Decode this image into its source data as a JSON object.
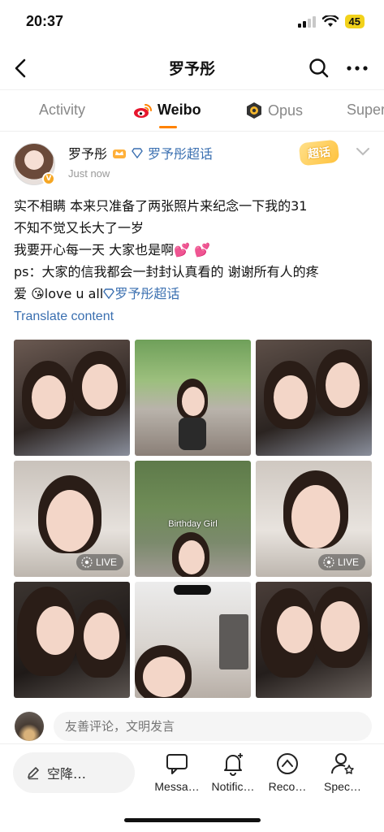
{
  "status": {
    "time": "20:37",
    "battery": "45"
  },
  "header": {
    "title": "罗予彤"
  },
  "tabs": [
    {
      "label": "Activity"
    },
    {
      "label": "Weibo"
    },
    {
      "label": "Opus"
    },
    {
      "label": "Super"
    }
  ],
  "post": {
    "author": "罗予彤",
    "supertopic": "罗予彤超话",
    "super_tag": "超话",
    "time": "Just now",
    "lines": [
      "实不相瞒 本来只准备了两张照片来纪念一下我的31",
      "不知不觉又长大了一岁",
      "我要开心每一天 大家也是啊💕 💕",
      "ps：大家的信我都会一封封认真看的 谢谢所有人的疼",
      "爱 😘love u all"
    ],
    "inline_topic": "罗予彤超话",
    "translate": "Translate content",
    "photos": [
      {
        "live": false
      },
      {
        "live": false
      },
      {
        "live": false
      },
      {
        "live": true,
        "badge": "LIVE"
      },
      {
        "live": false,
        "caption": "Birthday Girl"
      },
      {
        "live": true,
        "badge": "LIVE"
      },
      {
        "live": false
      },
      {
        "live": false
      },
      {
        "live": false
      }
    ]
  },
  "comment": {
    "placeholder": "友善评论，文明发言"
  },
  "bottom_nav": {
    "compose": "空降…",
    "items": [
      {
        "label": "Messa…",
        "icon": "message-icon"
      },
      {
        "label": "Notific…",
        "icon": "bell-icon"
      },
      {
        "label": "Reco…",
        "icon": "recommend-icon"
      },
      {
        "label": "Spec…",
        "icon": "special-follow-icon"
      }
    ]
  },
  "colors": {
    "accent": "#ff8200",
    "link": "#3a6fb0",
    "battery": "#f2d21b"
  }
}
